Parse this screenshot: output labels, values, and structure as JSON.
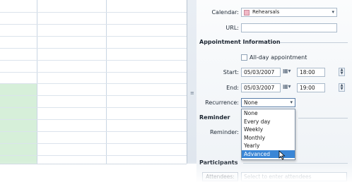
{
  "appointment": {
    "calendar_label": "Calendar:",
    "calendar_value": "Rehearsals",
    "calendar_color": "#f1b8c6",
    "url_label": "URL:",
    "url_value": ""
  },
  "appointment_info": {
    "title": "Appointment Information",
    "all_day_label": "All-day appointment",
    "all_day_checked": false,
    "start_label": "Start:",
    "start_date": "05/03/2007",
    "start_time": "18:00",
    "end_label": "End:",
    "end_date": "05/03/2007",
    "end_time": "19:00",
    "recurrence_label": "Recurrence:",
    "recurrence_value": "None",
    "recurrence_options": [
      "None",
      "Every day",
      "Weekly",
      "Monthly",
      "Yearly",
      "Advanced"
    ],
    "recurrence_highlighted": "Advanced"
  },
  "reminder": {
    "title": "Reminder",
    "reminder_label": "Reminder:"
  },
  "participants": {
    "title": "Participants",
    "attendees_button": "Attendees:",
    "attendees_placeholder": "Select to enter attendees"
  },
  "colors": {
    "selection": "#3a86d6",
    "grid_highlight": "#d6efd9"
  }
}
